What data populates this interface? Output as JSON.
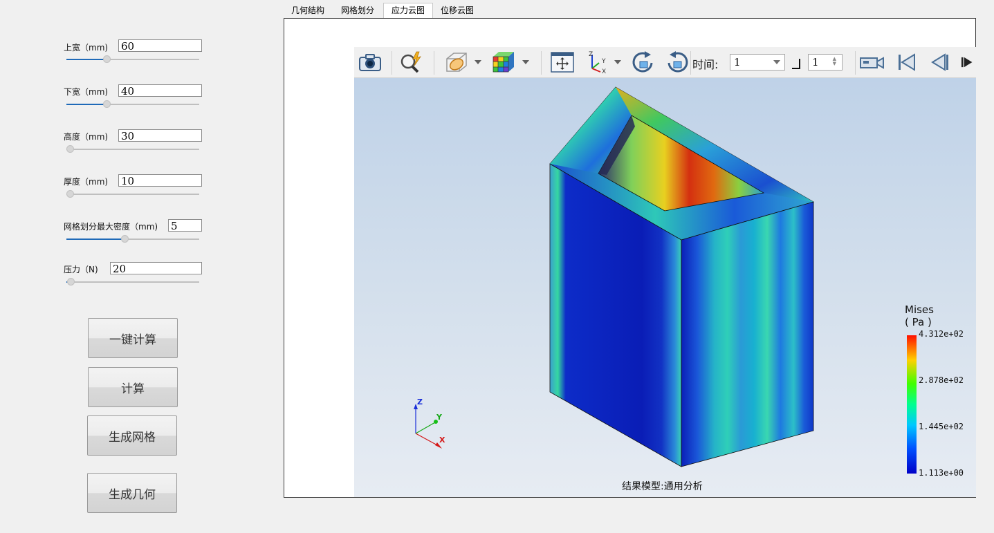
{
  "params": [
    {
      "label": "上宽（mm)",
      "value": "60",
      "fill": 0.3
    },
    {
      "label": "下宽（mm)",
      "value": "40",
      "fill": 0.3
    },
    {
      "label": "高度（mm)",
      "value": "30",
      "fill": 0.0
    },
    {
      "label": "厚度（mm)",
      "value": "10",
      "fill": 0.0
    },
    {
      "label": "网格划分最大密度（mm)",
      "value": "5",
      "fill": 0.44
    },
    {
      "label": "压力（N)",
      "value": "20",
      "fill": 0.03
    }
  ],
  "buttons": {
    "one_click": "一键计算",
    "calculate": "计算",
    "gen_mesh": "生成网格",
    "gen_geometry": "生成几何"
  },
  "tabs": [
    "几何结构",
    "网格划分",
    "应力云图",
    "位移云图"
  ],
  "active_tab": 2,
  "toolbar": {
    "time_label": "时间:",
    "time_value": "1",
    "step_value": "1",
    "icons": [
      "camera-icon",
      "magnify-icon",
      "section-plane-icon",
      "mesh-cube-icon",
      "fit-view-icon",
      "axes-icon",
      "rotate-cw-icon",
      "rotate-ccw-icon",
      "video-icon",
      "first-frame-icon",
      "prev-frame-icon",
      "next-frame-icon"
    ]
  },
  "legend": {
    "title": "Mises",
    "unit": "( Pa )",
    "max": "4.312e+02",
    "v2": "2.878e+02",
    "v3": "1.445e+02",
    "min": "1.113e+00"
  },
  "triad": {
    "x": "X",
    "y": "Y",
    "z": "Z"
  },
  "footer": "结果模型:通用分析",
  "colors": {
    "accent": "#1f6ab8",
    "bg": "#f0f0f0"
  }
}
